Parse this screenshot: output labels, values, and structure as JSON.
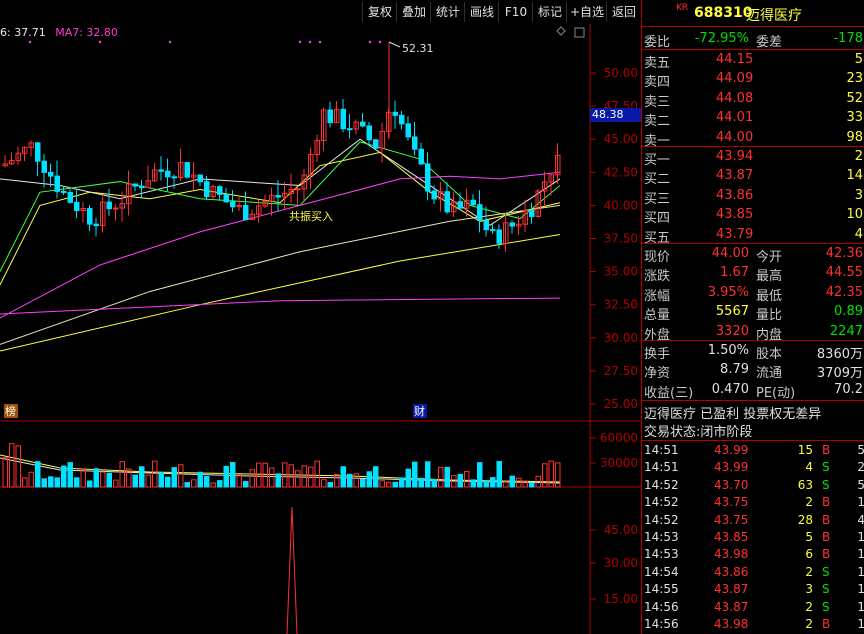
{
  "toolbar": {
    "buttons": [
      "复权",
      "叠加",
      "统计",
      "画线",
      "F10",
      "标记",
      "+自选",
      "返回"
    ]
  },
  "legend": {
    "ma1": "6: 37.71",
    "ma2": "MA7: 32.80"
  },
  "chart": {
    "price_axis": [
      "50.00",
      "47.50",
      "45.00",
      "42.50",
      "40.00",
      "37.50",
      "35.00",
      "32.50",
      "30.00",
      "27.50",
      "25.00"
    ],
    "volume_axis": [
      "60000",
      "30000"
    ],
    "indicator_axis": [
      "45.00",
      "30.00",
      "15.00"
    ],
    "high_marker": "52.31",
    "current_price_label": "48.38",
    "annotation": "共振买入",
    "badge_left": "榜",
    "badge_fin": "财"
  },
  "chart_data": {
    "type": "candlestick",
    "ylim": [
      25,
      52.31
    ],
    "annotations": [
      "52.31",
      "共振买入"
    ]
  },
  "panel": {
    "kr": "KR",
    "code": "688310",
    "name": "迈得医疗",
    "weibi_label": "委比",
    "weibi": "-72.95%",
    "weicha_label": "委差",
    "weicha": "-178",
    "asks": [
      {
        "label": "卖五",
        "price": "44.15",
        "vol": "5"
      },
      {
        "label": "卖四",
        "price": "44.09",
        "vol": "23"
      },
      {
        "label": "卖三",
        "price": "44.08",
        "vol": "52"
      },
      {
        "label": "卖二",
        "price": "44.01",
        "vol": "33"
      },
      {
        "label": "卖一",
        "price": "44.00",
        "vol": "98"
      }
    ],
    "bids": [
      {
        "label": "买一",
        "price": "43.94",
        "vol": "2"
      },
      {
        "label": "买二",
        "price": "43.87",
        "vol": "14"
      },
      {
        "label": "买三",
        "price": "43.86",
        "vol": "3"
      },
      {
        "label": "买四",
        "price": "43.85",
        "vol": "10"
      },
      {
        "label": "买五",
        "price": "43.79",
        "vol": "4"
      }
    ],
    "quote": [
      {
        "l1": "现价",
        "v1": "44.00",
        "c1": "red",
        "l2": "今开",
        "v2": "42.36",
        "c2": "red"
      },
      {
        "l1": "涨跌",
        "v1": "1.67",
        "c1": "red",
        "l2": "最高",
        "v2": "44.55",
        "c2": "red"
      },
      {
        "l1": "涨幅",
        "v1": "3.95%",
        "c1": "red",
        "l2": "最低",
        "v2": "42.35",
        "c2": "red"
      },
      {
        "l1": "总量",
        "v1": "5567",
        "c1": "yel",
        "l2": "量比",
        "v2": "0.89",
        "c2": "grn"
      },
      {
        "l1": "外盘",
        "v1": "3320",
        "c1": "red",
        "l2": "内盘",
        "v2": "2247",
        "c2": "grn"
      }
    ],
    "stats": [
      {
        "l1": "换手",
        "v1": "1.50%",
        "l2": "股本",
        "v2": "8360万"
      },
      {
        "l1": "净资",
        "v1": "8.79",
        "l2": "流通",
        "v2": "3709万"
      },
      {
        "l1": "收益(三)",
        "v1": "0.470",
        "l2": "PE(动)",
        "v2": "70.2"
      }
    ],
    "info1": "迈得医疗 已盈利 投票权无差异",
    "info2": "交易状态:闭市阶段",
    "ticks": [
      {
        "time": "14:51",
        "price": "43.99",
        "vol": "15",
        "side": "B",
        "n": "5"
      },
      {
        "time": "14:51",
        "price": "43.99",
        "vol": "4",
        "side": "S",
        "n": "2"
      },
      {
        "time": "14:52",
        "price": "43.70",
        "vol": "63",
        "side": "S",
        "n": "5"
      },
      {
        "time": "14:52",
        "price": "43.75",
        "vol": "2",
        "side": "B",
        "n": "1"
      },
      {
        "time": "14:52",
        "price": "43.75",
        "vol": "28",
        "side": "B",
        "n": "4"
      },
      {
        "time": "14:53",
        "price": "43.85",
        "vol": "5",
        "side": "B",
        "n": "1"
      },
      {
        "time": "14:53",
        "price": "43.98",
        "vol": "6",
        "side": "B",
        "n": "1"
      },
      {
        "time": "14:54",
        "price": "43.86",
        "vol": "2",
        "side": "S",
        "n": "1"
      },
      {
        "time": "14:55",
        "price": "43.87",
        "vol": "3",
        "side": "S",
        "n": "1"
      },
      {
        "time": "14:56",
        "price": "43.87",
        "vol": "2",
        "side": "S",
        "n": "1"
      },
      {
        "time": "14:56",
        "price": "43.98",
        "vol": "2",
        "side": "B",
        "n": "1"
      }
    ]
  },
  "colors": {
    "up": "#ff3030",
    "down": "#00e0ff",
    "grid": "#b00000",
    "ma_white": "#e8e8e8",
    "ma_yellow": "#ffff40",
    "ma_magenta": "#ff40ff",
    "ma_green": "#40ff40"
  }
}
